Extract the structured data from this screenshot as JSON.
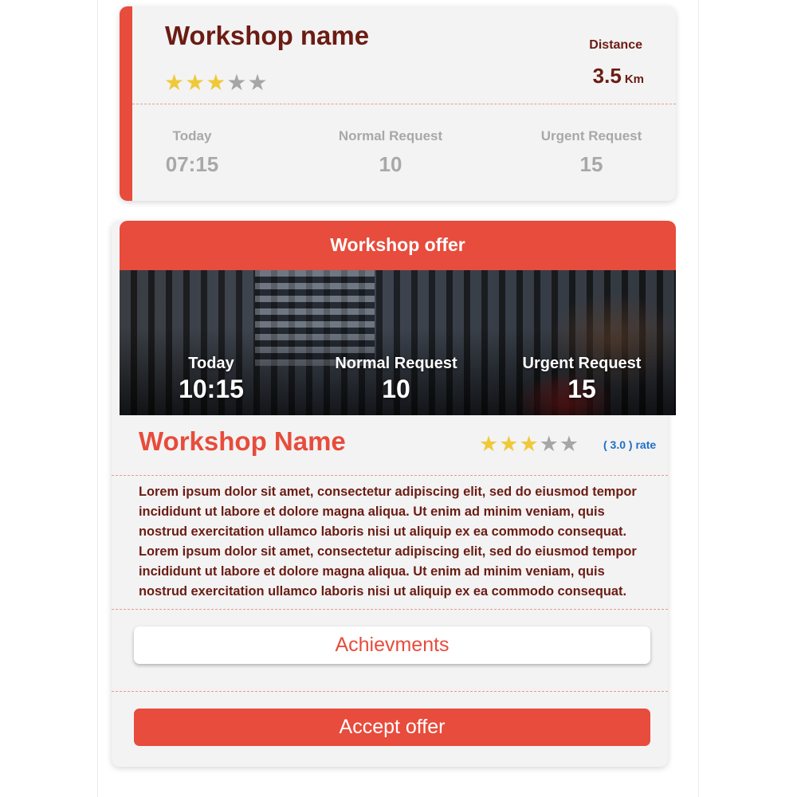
{
  "workshop_card": {
    "title": "Workshop name",
    "rating": {
      "filled": 3,
      "total": 5
    },
    "distance_label": "Distance",
    "distance_value": "3.5",
    "distance_unit": "Km",
    "stats": [
      {
        "label": "Today",
        "value": "07:15"
      },
      {
        "label": "Normal Request",
        "value": "10"
      },
      {
        "label": "Urgent Request",
        "value": "15"
      }
    ]
  },
  "offer_card": {
    "header": "Workshop offer",
    "banner_stats": [
      {
        "label": "Today",
        "value": "10:15"
      },
      {
        "label": "Normal Request",
        "value": "10"
      },
      {
        "label": "Urgent Request",
        "value": "15"
      }
    ],
    "name": "Workshop Name",
    "rating": {
      "filled": 3,
      "total": 5
    },
    "rate_text": "( 3.0 ) rate",
    "description": "Lorem ipsum dolor sit amet, consectetur adipiscing elit, sed do eiusmod tempor incididunt ut labore et dolore magna aliqua. Ut enim ad minim veniam, quis nostrud exercitation ullamco laboris nisi ut aliquip ex ea commodo consequat. Lorem ipsum dolor sit amet, consectetur adipiscing elit, sed do eiusmod tempor incididunt ut labore et dolore magna aliqua. Ut enim ad minim veniam, quis nostrud exercitation ullamco laboris nisi ut aliquip ex ea commodo consequat.",
    "achievements_label": "Achievments",
    "accept_label": "Accept offer"
  },
  "colors": {
    "accent": "#e74c3c",
    "dark_red": "#6b1c14",
    "star_on": "#f0c93a",
    "star_off": "#a6a6a6",
    "rate_blue": "#1f6fc4",
    "muted": "#a8a8a8"
  },
  "icons": {
    "rating_star": "star-icon"
  }
}
